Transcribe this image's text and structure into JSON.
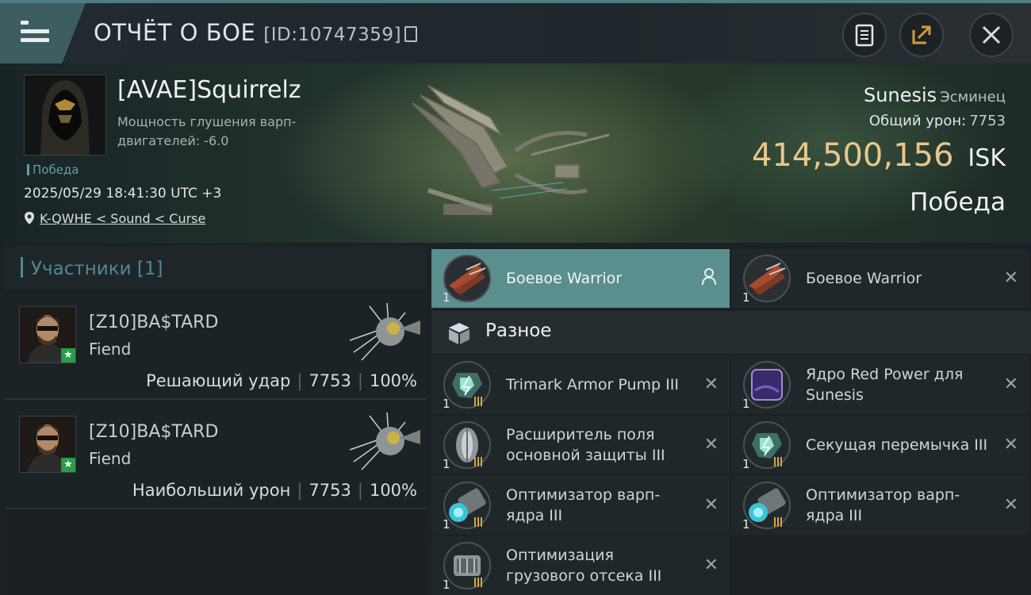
{
  "header": {
    "title": "ОТЧЁТ О БОЕ",
    "report_id": "[ID:10747359]"
  },
  "victim": {
    "name": "[AVAE]Squirrelz",
    "warp_disruption": "Мощность глушения варп-двигателей: -6.0",
    "victory_tag": "Победа",
    "date": "2025/05/29 18:41:30 UTC +3",
    "location": "K-QWHE < Sound < Curse",
    "ship": "Sunesis",
    "ship_class": "Эсминец",
    "total_damage_label": "Общий урон:",
    "total_damage": "7753",
    "isk_value": "414,500,156",
    "isk_unit": "ISK",
    "result": "Победа"
  },
  "participants": {
    "header": "Участники [1]",
    "rows": [
      {
        "name": "[Z10]BA$TARD",
        "ship": "Fiend",
        "role": "Решающий удар",
        "damage": "7753",
        "percent": "100%"
      },
      {
        "name": "[Z10]BA$TARD",
        "ship": "Fiend",
        "role": "Наибольший урон",
        "damage": "7753",
        "percent": "100%"
      }
    ]
  },
  "fitting": {
    "drones": [
      {
        "label": "Боевое Warrior",
        "qty": "1",
        "state": "active"
      },
      {
        "label": "Боевое Warrior",
        "qty": "1",
        "state": "destroyed"
      }
    ],
    "misc_header": "Разное",
    "items": [
      {
        "label": "Trimark Armor Pump III",
        "qty": "1",
        "icon": "armor-rig-icon"
      },
      {
        "label": "Ядро Red Power для Sunesis",
        "qty": "1",
        "icon": "power-core-icon"
      },
      {
        "label": "Расширитель поля основной защиты III",
        "qty": "1",
        "icon": "shield-extender-icon"
      },
      {
        "label": "Секущая перемычка III",
        "qty": "1",
        "icon": "armor-rig-icon"
      },
      {
        "label": "Оптимизатор варп-ядра III",
        "qty": "1",
        "icon": "warp-optimizer-icon"
      },
      {
        "label": "Оптимизатор варп-ядра III",
        "qty": "1",
        "icon": "warp-optimizer-icon"
      },
      {
        "label": "Оптимизация грузового отсека III",
        "qty": "1",
        "icon": "cargo-optimizer-icon"
      }
    ]
  },
  "colors": {
    "accent": "#5a8f8e",
    "isk": "#e9c78a",
    "victory": "#5fa3a1",
    "tier": "#d6a63c"
  }
}
